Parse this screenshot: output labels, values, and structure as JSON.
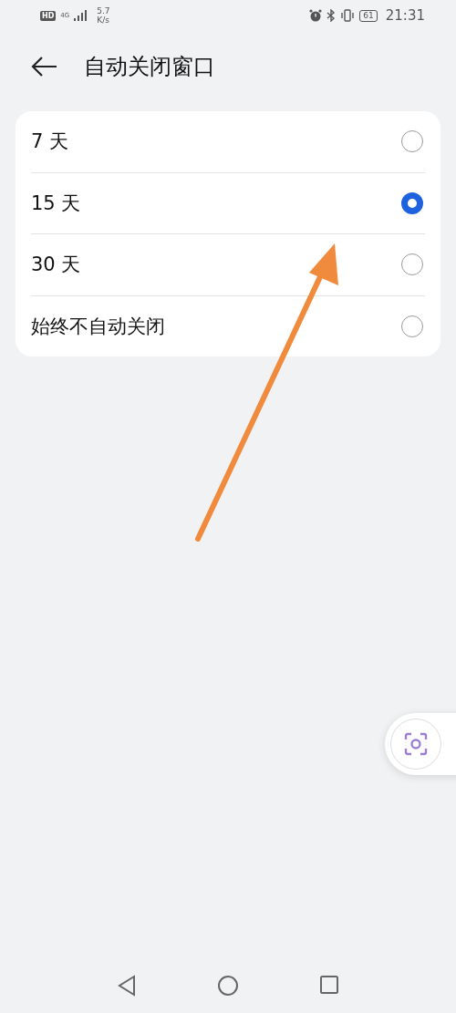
{
  "status_bar": {
    "hd": "HD",
    "network": "4G",
    "speed": "5.7",
    "speed_unit": "K/s",
    "battery": "61",
    "time": "21:31"
  },
  "header": {
    "title": "自动关闭窗口"
  },
  "options": [
    {
      "label": "7 天",
      "selected": false
    },
    {
      "label": "15 天",
      "selected": true
    },
    {
      "label": "30 天",
      "selected": false
    },
    {
      "label": "始终不自动关闭",
      "selected": false
    }
  ]
}
